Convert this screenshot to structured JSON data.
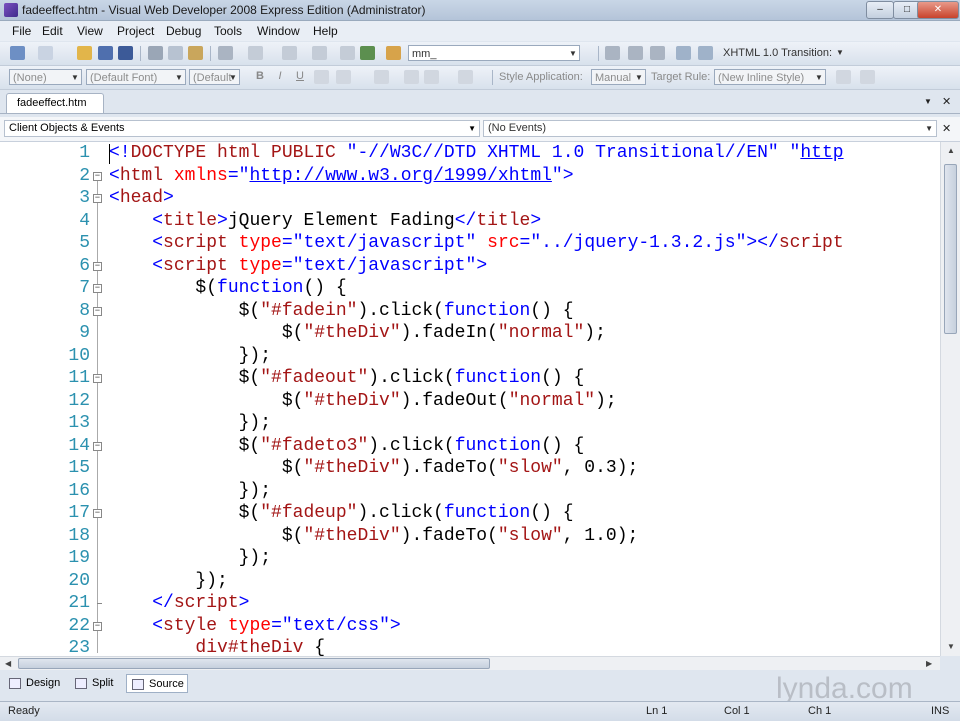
{
  "window": {
    "title": "fadeeffect.htm - Visual Web Developer 2008 Express Edition (Administrator)",
    "buttons": {
      "minimize": "–",
      "maximize": "□",
      "close": "✕"
    }
  },
  "menu": [
    "File",
    "Edit",
    "View",
    "Project",
    "Debug",
    "Tools",
    "Window",
    "Help"
  ],
  "toolbar1": {
    "find_value": "mm_",
    "doctype_value": "XHTML 1.0 Transition:"
  },
  "toolbar2": {
    "block_format": "(None)",
    "font": "(Default Font)",
    "size": "(Default",
    "bold": "B",
    "italic": "I",
    "underline": "U",
    "style_application_label": "Style Application:",
    "style_application_value": "Manual",
    "target_rule_label": "Target Rule:",
    "target_rule_value": "(New Inline Style)"
  },
  "tabs": {
    "document_tab": "fadeeffect.htm",
    "dropdown_glyph": "▼",
    "close_glyph": "✕"
  },
  "navigation": {
    "objects": "Client Objects & Events",
    "events": "(No Events)",
    "close_glyph": "✕"
  },
  "editor": {
    "line_numbers": [
      "1",
      "2",
      "3",
      "4",
      "5",
      "6",
      "7",
      "8",
      "9",
      "10",
      "11",
      "12",
      "13",
      "14",
      "15",
      "16",
      "17",
      "18",
      "19",
      "20",
      "21",
      "22",
      "23"
    ],
    "lines": [
      [
        [
          "delim",
          "<!"
        ],
        [
          "tag",
          "DOCTYPE html PUBLIC "
        ],
        [
          "str",
          "\"-//W3C//DTD XHTML 1.0 Transitional//EN\""
        ],
        [
          "plain",
          " "
        ],
        [
          "str",
          "\""
        ],
        [
          "link",
          "http"
        ]
      ],
      [
        [
          "delim",
          "<"
        ],
        [
          "tag",
          "html "
        ],
        [
          "attr",
          "xmlns"
        ],
        [
          "delim",
          "="
        ],
        [
          "str",
          "\""
        ],
        [
          "link",
          "http://www.w3.org/1999/xhtml"
        ],
        [
          "str",
          "\""
        ],
        [
          "delim",
          ">"
        ]
      ],
      [
        [
          "delim",
          "<"
        ],
        [
          "tag",
          "head"
        ],
        [
          "delim",
          ">"
        ]
      ],
      [
        [
          "plain",
          "    "
        ],
        [
          "delim",
          "<"
        ],
        [
          "tag",
          "title"
        ],
        [
          "delim",
          ">"
        ],
        [
          "plain",
          "jQuery Element Fading"
        ],
        [
          "delim",
          "</"
        ],
        [
          "tag",
          "title"
        ],
        [
          "delim",
          ">"
        ]
      ],
      [
        [
          "plain",
          "    "
        ],
        [
          "delim",
          "<"
        ],
        [
          "tag",
          "script "
        ],
        [
          "attr",
          "type"
        ],
        [
          "delim",
          "="
        ],
        [
          "str",
          "\"text/javascript\""
        ],
        [
          "plain",
          " "
        ],
        [
          "attr",
          "src"
        ],
        [
          "delim",
          "="
        ],
        [
          "str",
          "\"../jquery-1.3.2.js\""
        ],
        [
          "delim",
          "></"
        ],
        [
          "tag",
          "script"
        ]
      ],
      [
        [
          "plain",
          "    "
        ],
        [
          "delim",
          "<"
        ],
        [
          "tag",
          "script "
        ],
        [
          "attr",
          "type"
        ],
        [
          "delim",
          "="
        ],
        [
          "str",
          "\"text/javascript\""
        ],
        [
          "delim",
          ">"
        ]
      ],
      [
        [
          "plain",
          "        $("
        ],
        [
          "kw",
          "function"
        ],
        [
          "plain",
          "() {"
        ]
      ],
      [
        [
          "plain",
          "            $("
        ],
        [
          "jstr",
          "\"#fadein\""
        ],
        [
          "plain",
          ").click("
        ],
        [
          "kw",
          "function"
        ],
        [
          "plain",
          "() {"
        ]
      ],
      [
        [
          "plain",
          "                $("
        ],
        [
          "jstr",
          "\"#theDiv\""
        ],
        [
          "plain",
          ").fadeIn("
        ],
        [
          "jstr",
          "\"normal\""
        ],
        [
          "plain",
          ");"
        ]
      ],
      [
        [
          "plain",
          "            });"
        ]
      ],
      [
        [
          "plain",
          "            $("
        ],
        [
          "jstr",
          "\"#fadeout\""
        ],
        [
          "plain",
          ").click("
        ],
        [
          "kw",
          "function"
        ],
        [
          "plain",
          "() {"
        ]
      ],
      [
        [
          "plain",
          "                $("
        ],
        [
          "jstr",
          "\"#theDiv\""
        ],
        [
          "plain",
          ").fadeOut("
        ],
        [
          "jstr",
          "\"normal\""
        ],
        [
          "plain",
          ");"
        ]
      ],
      [
        [
          "plain",
          "            });"
        ]
      ],
      [
        [
          "plain",
          "            $("
        ],
        [
          "jstr",
          "\"#fadeto3\""
        ],
        [
          "plain",
          ").click("
        ],
        [
          "kw",
          "function"
        ],
        [
          "plain",
          "() {"
        ]
      ],
      [
        [
          "plain",
          "                $("
        ],
        [
          "jstr",
          "\"#theDiv\""
        ],
        [
          "plain",
          ").fadeTo("
        ],
        [
          "jstr",
          "\"slow\""
        ],
        [
          "plain",
          ", 0.3);"
        ]
      ],
      [
        [
          "plain",
          "            });"
        ]
      ],
      [
        [
          "plain",
          "            $("
        ],
        [
          "jstr",
          "\"#fadeup\""
        ],
        [
          "plain",
          ").click("
        ],
        [
          "kw",
          "function"
        ],
        [
          "plain",
          "() {"
        ]
      ],
      [
        [
          "plain",
          "                $("
        ],
        [
          "jstr",
          "\"#theDiv\""
        ],
        [
          "plain",
          ").fadeTo("
        ],
        [
          "jstr",
          "\"slow\""
        ],
        [
          "plain",
          ", 1.0);"
        ]
      ],
      [
        [
          "plain",
          "            });"
        ]
      ],
      [
        [
          "plain",
          "        });"
        ]
      ],
      [
        [
          "plain",
          "    "
        ],
        [
          "delim",
          "</"
        ],
        [
          "tag",
          "script"
        ],
        [
          "delim",
          ">"
        ]
      ],
      [
        [
          "plain",
          "    "
        ],
        [
          "delim",
          "<"
        ],
        [
          "tag",
          "style "
        ],
        [
          "attr",
          "type"
        ],
        [
          "delim",
          "="
        ],
        [
          "str",
          "\"text/css\""
        ],
        [
          "delim",
          ">"
        ]
      ],
      [
        [
          "plain",
          "        "
        ],
        [
          "tag",
          "div#theDiv"
        ],
        [
          "plain",
          " {"
        ]
      ]
    ],
    "fold_lines": [
      2,
      3,
      6,
      7,
      8,
      11,
      14,
      17,
      22
    ],
    "tick_lines": [
      21
    ],
    "colors": {
      "line_number": "#2b91af",
      "tag": "#a31515",
      "attribute": "#ff0000",
      "value": "#0000ff",
      "keyword": "#0000ff"
    }
  },
  "view_tabs": [
    "Design",
    "Split",
    "Source"
  ],
  "active_view": "Source",
  "watermark": "lynda.com",
  "status": {
    "state": "Ready",
    "line": "Ln 1",
    "col": "Col 1",
    "ch": "Ch 1",
    "mode": "INS"
  }
}
